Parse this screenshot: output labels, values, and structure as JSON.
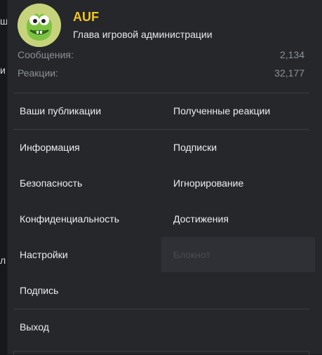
{
  "background": {
    "fragment_top": "ш",
    "fragment_mid": "и",
    "fragment_low": "л"
  },
  "user": {
    "avatar_icon": "frog-avatar-icon",
    "name": "AUF",
    "name_color": "#f3c520",
    "title": "Глава игровой администрации",
    "stats": [
      {
        "label": "Сообщения:",
        "value": "2,134"
      },
      {
        "label": "Реакции:",
        "value": "32,177"
      }
    ]
  },
  "menu": {
    "publications": "Ваши публикации",
    "reactions_received": "Полученные реакции",
    "info": "Информация",
    "subscriptions": "Подписки",
    "security": "Безопасность",
    "ignoring": "Игнорирование",
    "privacy": "Конфиденциальность",
    "achievements": "Достижения",
    "settings": "Настройки",
    "notepad": "Блокнот",
    "signature": "Подпись",
    "logout": "Выход"
  }
}
